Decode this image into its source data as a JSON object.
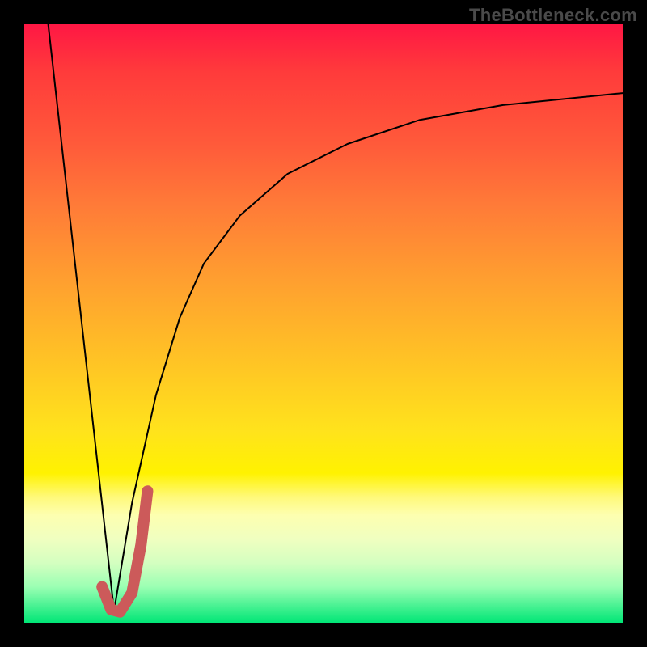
{
  "watermark": "TheBottleneck.com",
  "chart_data": {
    "type": "line",
    "title": "",
    "xlabel": "",
    "ylabel": "",
    "xlim": [
      0,
      100
    ],
    "ylim": [
      0,
      100
    ],
    "series": [
      {
        "name": "left-falling-line",
        "x": [
          4,
          15
        ],
        "y": [
          100,
          2
        ],
        "stroke": "#000000",
        "width": 2
      },
      {
        "name": "rising-curve",
        "x": [
          15,
          18,
          22,
          26,
          30,
          36,
          44,
          54,
          66,
          80,
          100
        ],
        "y": [
          2,
          20,
          38,
          51,
          60,
          68,
          75,
          80,
          84,
          86.5,
          88.5
        ],
        "stroke": "#000000",
        "width": 2
      },
      {
        "name": "marker-j",
        "x": [
          13,
          14.5,
          16,
          18,
          19.5,
          20.6
        ],
        "y": [
          6,
          2.2,
          1.8,
          5,
          13,
          22
        ],
        "stroke": "#cc5a5a",
        "width": 14
      }
    ],
    "gradient_stops": [
      {
        "pct": 0,
        "color": "#ff1744"
      },
      {
        "pct": 8,
        "color": "#ff3b3b"
      },
      {
        "pct": 20,
        "color": "#ff5a3a"
      },
      {
        "pct": 30,
        "color": "#ff7a38"
      },
      {
        "pct": 42,
        "color": "#ff9d30"
      },
      {
        "pct": 55,
        "color": "#ffc026"
      },
      {
        "pct": 68,
        "color": "#ffe31c"
      },
      {
        "pct": 75,
        "color": "#fff200"
      },
      {
        "pct": 79,
        "color": "#fff97a"
      },
      {
        "pct": 82,
        "color": "#fdffb0"
      },
      {
        "pct": 86,
        "color": "#f0ffc0"
      },
      {
        "pct": 90,
        "color": "#d4ffc0"
      },
      {
        "pct": 94,
        "color": "#9bffb3"
      },
      {
        "pct": 100,
        "color": "#00e676"
      }
    ]
  }
}
